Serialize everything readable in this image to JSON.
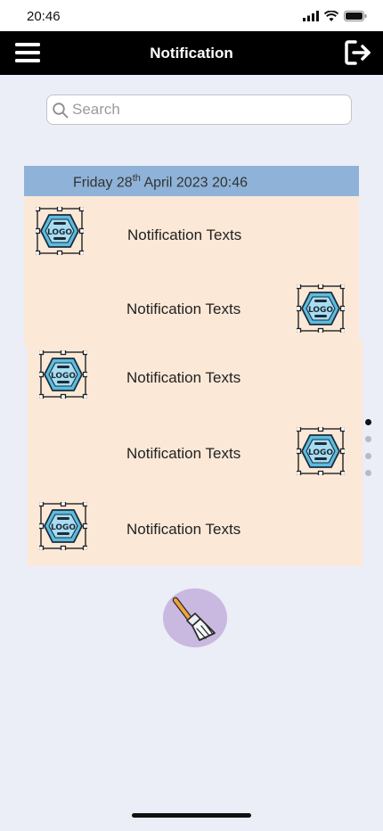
{
  "status_bar": {
    "time": "20:46"
  },
  "header": {
    "title": "Notification",
    "menu_icon": "hamburger-menu-icon",
    "logout_icon": "logout-icon"
  },
  "search": {
    "placeholder": "Search",
    "value": ""
  },
  "date_header": {
    "day_prefix": "Friday 28",
    "ordinal": "th",
    "rest": " April 2023 20:46"
  },
  "notifications": [
    {
      "text": "Notification Texts",
      "logo_side": "left",
      "logo_label": "LOGO"
    },
    {
      "text": "Notification Texts",
      "logo_side": "right",
      "logo_label": "LOGO"
    },
    {
      "text": "Notification Texts",
      "logo_side": "left",
      "logo_label": "LOGO"
    },
    {
      "text": "Notification Texts",
      "logo_side": "right",
      "logo_label": "LOGO"
    },
    {
      "text": "Notification Texts",
      "logo_side": "left",
      "logo_label": "LOGO"
    }
  ],
  "page_indicator": {
    "count": 4,
    "active": 1
  },
  "actions": {
    "clear_icon": "broom-icon"
  },
  "colors": {
    "header_bg": "#000000",
    "date_bg": "#8fb3d8",
    "card_bg": "#fbe8d7",
    "clear_btn_bg": "#c9b8e0",
    "page_bg": "#ebedf7"
  }
}
